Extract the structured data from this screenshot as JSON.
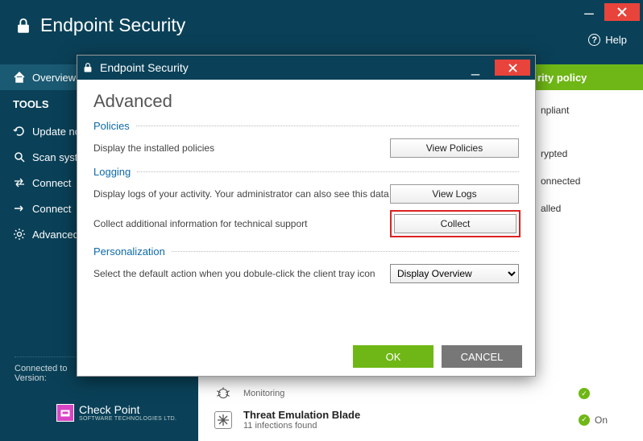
{
  "outer": {
    "title": "Endpoint Security",
    "help": "Help"
  },
  "sidebar": {
    "items": [
      {
        "label": "Overview"
      },
      {
        "heading": "TOOLS"
      },
      {
        "label": "Update now"
      },
      {
        "label": "Scan system"
      },
      {
        "label": "Connect"
      },
      {
        "label": "Connect"
      },
      {
        "label": "Advanced"
      }
    ]
  },
  "right": {
    "header": "rity policy",
    "items": [
      "npliant",
      "",
      "rypted",
      "onnected",
      "alled"
    ]
  },
  "status": {
    "line1": "Connected to",
    "line2": "Version:"
  },
  "logo": {
    "line1": "Check Point",
    "line2": "SOFTWARE TECHNOLOGIES LTD."
  },
  "blades": [
    {
      "name": "",
      "sub": "Monitoring",
      "status": ""
    },
    {
      "name": "Threat Emulation Blade",
      "sub": "11 infections found",
      "status": "On"
    }
  ],
  "modal": {
    "title": "Endpoint Security",
    "heading": "Advanced",
    "sections": {
      "policies": {
        "title": "Policies",
        "row1_label": "Display the installed policies",
        "row1_btn": "View Policies"
      },
      "logging": {
        "title": "Logging",
        "row1_label": "Display logs of your activity. Your administrator can also see this data",
        "row1_btn": "View Logs",
        "row2_label": "Collect additional information for technical support",
        "row2_btn": "Collect"
      },
      "personalization": {
        "title": "Personalization",
        "row1_label": "Select the default action when you dobule-click the client tray icon",
        "row1_select": "Display Overview"
      }
    },
    "footer": {
      "ok": "OK",
      "cancel": "CANCEL"
    }
  }
}
